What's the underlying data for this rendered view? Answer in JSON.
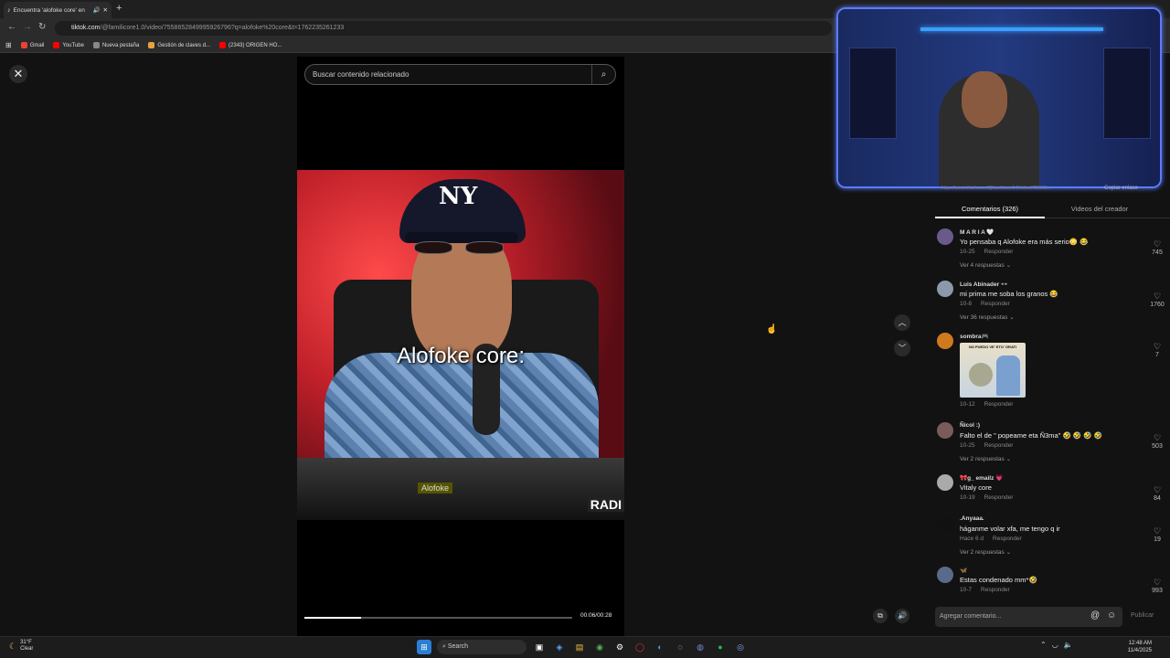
{
  "browser": {
    "tab_title": "Encuentra 'alofoke core' en",
    "new_tab_icon": "plus-icon",
    "url_host": "tiktok.com",
    "url_path": "/@familicore1.0/video/7558652849995926796?q=alofoke%20core&t=1762235261233",
    "bookmarks": [
      {
        "label": "Gmail",
        "color": "#ea4335"
      },
      {
        "label": "YouTube",
        "color": "#ff0000"
      },
      {
        "label": "Nueva pestaña",
        "color": "#888888"
      },
      {
        "label": "Gestión de claves d...",
        "color": "#e8a33d"
      },
      {
        "label": "(2343) ORIGEN HO...",
        "color": "#ff0000"
      }
    ]
  },
  "player": {
    "search_placeholder": "Buscar contenido relacionado",
    "caption": "Alofoke core:",
    "video_badge": "Alofoke",
    "video_radio": "RADI",
    "time": "00:06/00:28",
    "progress": 0.21
  },
  "side": {
    "link_cutoff": "https://www.tiktok.com/@familicore1.0/video/755865...",
    "copy_link": "Copiar enlace",
    "tab_comments": "Comentarios (326)",
    "tab_creator": "Videos del creador",
    "reply_label": "Responder",
    "comments": [
      {
        "name": "M A R I A 🤍",
        "text": "Yo pensaba q Alofoke era más serio😳 😂",
        "date": "10-25",
        "likes": "745",
        "replies": "Ver 4 respuestas ⌄",
        "avatar": "#6a5a8a"
      },
      {
        "name": "Luis Abinader 👓",
        "text": "mi prima me soba los granos 😂",
        "date": "10-8",
        "likes": "1760",
        "replies": "Ver 36 respuestas ⌄",
        "avatar": "#8a9aaa"
      },
      {
        "name": "sombra🎮",
        "text": "",
        "date": "10-12",
        "likes": "7",
        "replies": "",
        "avatar": "#d07a20",
        "sticker": "NO PUEDO VE' ETO' GRATI"
      },
      {
        "name": "Ñicol :)",
        "text": "Falto el de \" popeame eta Ñ3ma\" 🤣 🤣 🤣 🤣",
        "date": "10-25",
        "likes": "503",
        "replies": "Ver 2 respuestas ⌄",
        "avatar": "#7a5a5a"
      },
      {
        "name": "🎀g_ emailz 💗",
        "text": "Vitaly core",
        "date": "10-19",
        "likes": "84",
        "replies": "",
        "avatar": "#aaaaaa"
      },
      {
        "name": ".Anyaaa.",
        "text": "háganme volar xfa, me tengo q ir",
        "date": "Hace 6 d",
        "likes": "19",
        "replies": "Ver 2 respuestas ⌄",
        "avatar": "#111111"
      },
      {
        "name": "🦋",
        "text": "Estas condenado mm*🤣",
        "date": "10-7",
        "likes": "993",
        "replies": "",
        "avatar": "#5a6a8a"
      }
    ],
    "composer_placeholder": "Agregar comentario...",
    "publish": "Publicar"
  },
  "taskbar": {
    "weather_temp": "31°F",
    "weather_desc": "Clear",
    "search": "Search",
    "time": "12:48 AM",
    "date": "11/4/2025"
  },
  "colors": {
    "accent": "#fe2c55",
    "webcam_border": "#5a7cff"
  }
}
